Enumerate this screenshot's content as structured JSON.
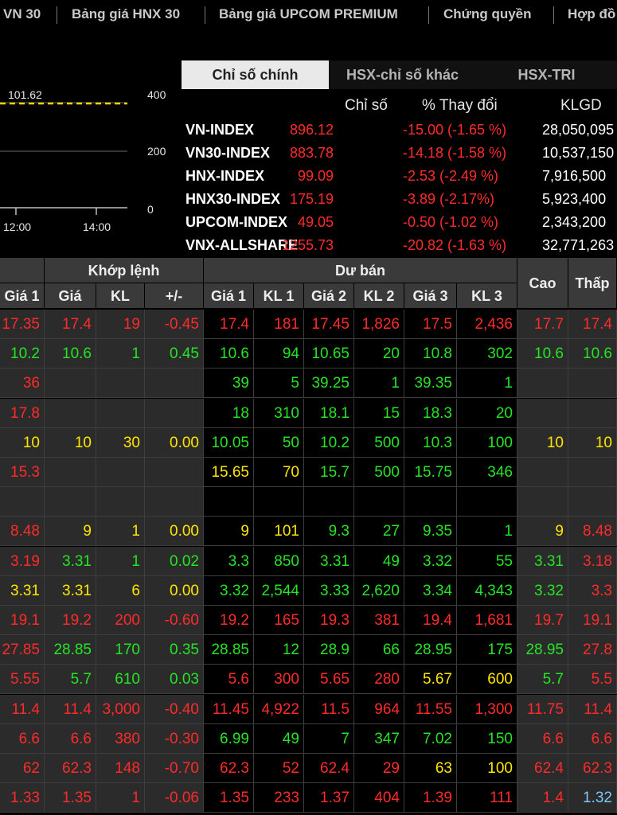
{
  "nav": {
    "tabs": [
      "VN 30",
      "Bảng giá HNX 30",
      "Bảng giá UPCOM PREMIUM",
      "Chứng quyền",
      "Hợp đồ"
    ]
  },
  "chart": {
    "marker_value": "101.62",
    "y_ticks": [
      "400",
      "200",
      "0"
    ],
    "x_ticks": [
      "12:00",
      "14:00"
    ],
    "marker_color": "#ffd400"
  },
  "index_panel": {
    "tabs": [
      "Chỉ số chính",
      "HSX-chỉ số khác",
      "HSX-TRI"
    ],
    "active_tab": 0,
    "headers": {
      "value": "Chỉ số",
      "change": "% Thay đổi",
      "volume": "KLGD"
    },
    "rows": [
      {
        "name": "VN-INDEX",
        "value": "896.12",
        "change": "-15.00 (-1.65 %)",
        "volume": "28,050,095"
      },
      {
        "name": "VN30-INDEX",
        "value": "883.78",
        "change": "-14.18 (-1.58 %)",
        "volume": "10,537,150"
      },
      {
        "name": "HNX-INDEX",
        "value": "99.09",
        "change": "-2.53 (-2.49 %)",
        "volume": "7,916,500"
      },
      {
        "name": "HNX30-INDEX",
        "value": "175.19",
        "change": "-3.89 (-2.17%)",
        "volume": "5,923,400"
      },
      {
        "name": "UPCOM-INDEX",
        "value": "49.05",
        "change": "-0.50 (-1.02 %)",
        "volume": "2,343,200"
      },
      {
        "name": "VNX-ALLSHARE",
        "value": "1255.73",
        "change": "-20.82 (-1.63 %)",
        "volume": "32,771,263"
      }
    ]
  },
  "board": {
    "group_headers": {
      "matched": "Khớp lệnh",
      "ask": "Dư bán"
    },
    "columns": {
      "bid_price1": "Giá 1",
      "match_price": "Giá",
      "match_vol": "KL",
      "match_change": "+/-",
      "ask_price1": "Giá 1",
      "ask_vol1": "KL 1",
      "ask_price2": "Giá 2",
      "ask_vol2": "KL 2",
      "ask_price3": "Giá 3",
      "ask_vol3": "KL 3",
      "high": "Cao",
      "low": "Thấp"
    },
    "rows": [
      [
        [
          "17.35",
          "r"
        ],
        [
          "17.4",
          "r"
        ],
        [
          "19",
          "r"
        ],
        [
          "-0.45",
          "r"
        ],
        [
          "17.4",
          "r"
        ],
        [
          "181",
          "r"
        ],
        [
          "17.45",
          "r"
        ],
        [
          "1,826",
          "r"
        ],
        [
          "17.5",
          "r"
        ],
        [
          "2,436",
          "r"
        ],
        [
          "17.7",
          "r"
        ],
        [
          "17.4",
          "r"
        ]
      ],
      [
        [
          "10.2",
          "g"
        ],
        [
          "10.6",
          "g"
        ],
        [
          "1",
          "g"
        ],
        [
          "0.45",
          "g"
        ],
        [
          "10.6",
          "g"
        ],
        [
          "94",
          "g"
        ],
        [
          "10.65",
          "g"
        ],
        [
          "20",
          "g"
        ],
        [
          "10.8",
          "g"
        ],
        [
          "302",
          "g"
        ],
        [
          "10.6",
          "g"
        ],
        [
          "10.6",
          "g"
        ]
      ],
      [
        [
          "36",
          "r"
        ],
        [
          "",
          ""
        ],
        [
          "",
          ""
        ],
        [
          "",
          ""
        ],
        [
          "39",
          "g"
        ],
        [
          "5",
          "g"
        ],
        [
          "39.25",
          "g"
        ],
        [
          "1",
          "g"
        ],
        [
          "39.35",
          "g"
        ],
        [
          "1",
          "g"
        ],
        [
          "",
          ""
        ],
        [
          "",
          ""
        ]
      ],
      [
        [
          "17.8",
          "r"
        ],
        [
          "",
          ""
        ],
        [
          "",
          ""
        ],
        [
          "",
          ""
        ],
        [
          "18",
          "g"
        ],
        [
          "310",
          "g"
        ],
        [
          "18.1",
          "g"
        ],
        [
          "15",
          "g"
        ],
        [
          "18.3",
          "g"
        ],
        [
          "20",
          "g"
        ],
        [
          "",
          ""
        ],
        [
          "",
          ""
        ]
      ],
      [
        [
          "10",
          "y"
        ],
        [
          "10",
          "y"
        ],
        [
          "30",
          "y"
        ],
        [
          "0.00",
          "y"
        ],
        [
          "10.05",
          "g"
        ],
        [
          "50",
          "g"
        ],
        [
          "10.2",
          "g"
        ],
        [
          "500",
          "g"
        ],
        [
          "10.3",
          "g"
        ],
        [
          "100",
          "g"
        ],
        [
          "10",
          "y"
        ],
        [
          "10",
          "y"
        ]
      ],
      [
        [
          "15.3",
          "r"
        ],
        [
          "",
          ""
        ],
        [
          "",
          ""
        ],
        [
          "",
          ""
        ],
        [
          "15.65",
          "y"
        ],
        [
          "70",
          "y"
        ],
        [
          "15.7",
          "g"
        ],
        [
          "500",
          "g"
        ],
        [
          "15.75",
          "g"
        ],
        [
          "346",
          "g"
        ],
        [
          "",
          ""
        ],
        [
          "",
          ""
        ]
      ],
      [
        [
          "",
          ""
        ],
        [
          "",
          ""
        ],
        [
          "",
          ""
        ],
        [
          "",
          ""
        ],
        [
          "",
          ""
        ],
        [
          "",
          ""
        ],
        [
          "",
          ""
        ],
        [
          "",
          ""
        ],
        [
          "",
          ""
        ],
        [
          "",
          ""
        ],
        [
          "",
          ""
        ],
        [
          "",
          ""
        ]
      ],
      [
        [
          "8.48",
          "r"
        ],
        [
          "9",
          "y"
        ],
        [
          "1",
          "y"
        ],
        [
          "0.00",
          "y"
        ],
        [
          "9",
          "y"
        ],
        [
          "101",
          "y"
        ],
        [
          "9.3",
          "g"
        ],
        [
          "27",
          "g"
        ],
        [
          "9.35",
          "g"
        ],
        [
          "1",
          "g"
        ],
        [
          "9",
          "y"
        ],
        [
          "8.48",
          "r"
        ]
      ],
      [
        [
          "3.19",
          "r"
        ],
        [
          "3.31",
          "g"
        ],
        [
          "1",
          "g"
        ],
        [
          "0.02",
          "g"
        ],
        [
          "3.3",
          "g"
        ],
        [
          "850",
          "g"
        ],
        [
          "3.31",
          "g"
        ],
        [
          "49",
          "g"
        ],
        [
          "3.32",
          "g"
        ],
        [
          "55",
          "g"
        ],
        [
          "3.31",
          "g"
        ],
        [
          "3.18",
          "r"
        ]
      ],
      [
        [
          "3.31",
          "y"
        ],
        [
          "3.31",
          "y"
        ],
        [
          "6",
          "y"
        ],
        [
          "0.00",
          "y"
        ],
        [
          "3.32",
          "g"
        ],
        [
          "2,544",
          "g"
        ],
        [
          "3.33",
          "g"
        ],
        [
          "2,620",
          "g"
        ],
        [
          "3.34",
          "g"
        ],
        [
          "4,343",
          "g"
        ],
        [
          "3.32",
          "g"
        ],
        [
          "3.3",
          "r"
        ]
      ],
      [
        [
          "19.1",
          "r"
        ],
        [
          "19.2",
          "r"
        ],
        [
          "200",
          "r"
        ],
        [
          "-0.60",
          "r"
        ],
        [
          "19.2",
          "r"
        ],
        [
          "165",
          "r"
        ],
        [
          "19.3",
          "r"
        ],
        [
          "381",
          "r"
        ],
        [
          "19.4",
          "r"
        ],
        [
          "1,681",
          "r"
        ],
        [
          "19.7",
          "r"
        ],
        [
          "19.1",
          "r"
        ]
      ],
      [
        [
          "27.85",
          "r"
        ],
        [
          "28.85",
          "g"
        ],
        [
          "170",
          "g"
        ],
        [
          "0.35",
          "g"
        ],
        [
          "28.85",
          "g"
        ],
        [
          "12",
          "g"
        ],
        [
          "28.9",
          "g"
        ],
        [
          "66",
          "g"
        ],
        [
          "28.95",
          "g"
        ],
        [
          "175",
          "g"
        ],
        [
          "28.95",
          "g"
        ],
        [
          "27.8",
          "r"
        ]
      ],
      [
        [
          "5.55",
          "r"
        ],
        [
          "5.7",
          "g"
        ],
        [
          "610",
          "g"
        ],
        [
          "0.03",
          "g"
        ],
        [
          "5.6",
          "r"
        ],
        [
          "300",
          "r"
        ],
        [
          "5.65",
          "r"
        ],
        [
          "280",
          "r"
        ],
        [
          "5.67",
          "y"
        ],
        [
          "600",
          "y"
        ],
        [
          "5.7",
          "g"
        ],
        [
          "5.5",
          "r"
        ]
      ],
      [
        [
          "11.4",
          "r"
        ],
        [
          "11.4",
          "r"
        ],
        [
          "3,000",
          "r"
        ],
        [
          "-0.40",
          "r"
        ],
        [
          "11.45",
          "r"
        ],
        [
          "4,922",
          "r"
        ],
        [
          "11.5",
          "r"
        ],
        [
          "964",
          "r"
        ],
        [
          "11.55",
          "r"
        ],
        [
          "1,300",
          "r"
        ],
        [
          "11.75",
          "r"
        ],
        [
          "11.4",
          "r"
        ]
      ],
      [
        [
          "6.6",
          "r"
        ],
        [
          "6.6",
          "r"
        ],
        [
          "380",
          "r"
        ],
        [
          "-0.30",
          "r"
        ],
        [
          "6.99",
          "g"
        ],
        [
          "49",
          "g"
        ],
        [
          "7",
          "g"
        ],
        [
          "347",
          "g"
        ],
        [
          "7.02",
          "g"
        ],
        [
          "150",
          "g"
        ],
        [
          "6.6",
          "r"
        ],
        [
          "6.6",
          "r"
        ]
      ],
      [
        [
          "62",
          "r"
        ],
        [
          "62.3",
          "r"
        ],
        [
          "148",
          "r"
        ],
        [
          "-0.70",
          "r"
        ],
        [
          "62.3",
          "r"
        ],
        [
          "52",
          "r"
        ],
        [
          "62.4",
          "r"
        ],
        [
          "29",
          "r"
        ],
        [
          "63",
          "y"
        ],
        [
          "100",
          "y"
        ],
        [
          "62.4",
          "r"
        ],
        [
          "62.3",
          "r"
        ]
      ],
      [
        [
          "1.33",
          "r"
        ],
        [
          "1.35",
          "r"
        ],
        [
          "1",
          "r"
        ],
        [
          "-0.06",
          "r"
        ],
        [
          "1.35",
          "r"
        ],
        [
          "233",
          "r"
        ],
        [
          "1.37",
          "r"
        ],
        [
          "404",
          "r"
        ],
        [
          "1.39",
          "r"
        ],
        [
          "111",
          "r"
        ],
        [
          "1.4",
          "r"
        ],
        [
          "1.32",
          "b"
        ]
      ]
    ]
  }
}
